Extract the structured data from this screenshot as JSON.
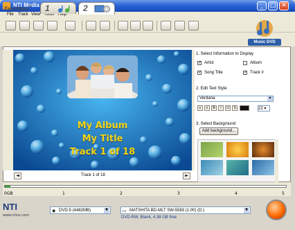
{
  "window": {
    "title": "NTI Media Maker 8",
    "min": "_",
    "max": "□",
    "close": "✕"
  },
  "menu": [
    "File",
    "Track",
    "View",
    "Tools",
    "Help"
  ],
  "toolbar": {
    "icons": [
      "new-icon",
      "open-icon",
      "save-icon",
      "home-icon",
      "refresh-icon",
      "open-folder-icon",
      "image-icon",
      "add-icon",
      "remove-icon",
      "list-icon",
      "settings-icon",
      "burn-settings-icon",
      "options-icon"
    ]
  },
  "steps": {
    "label": "EasySteps",
    "mark": "®",
    "tabs": [
      "1",
      "2"
    ]
  },
  "logo": {
    "text": "Music DVD"
  },
  "preview": {
    "lines": [
      "My Album",
      "My Title",
      "Track 1 of 18"
    ],
    "nav": {
      "prev": "◄",
      "next": "►",
      "label": "Track 1 of 18"
    }
  },
  "panel": {
    "section1": "1. Select Information to Display",
    "checks": [
      {
        "label": "Artist",
        "checked": true
      },
      {
        "label": "Album",
        "checked": false
      },
      {
        "label": "Song Title",
        "checked": true
      },
      {
        "label": "Track #",
        "checked": true
      }
    ],
    "section2": "2. Edit Text Style",
    "font": "Verdana",
    "style_buttons": [
      "B",
      "I",
      "U",
      "S"
    ],
    "font_size": "22",
    "section3": "3. Select Background",
    "add_background": "Add background..."
  },
  "capacity": {
    "labels": [
      "0GB",
      "1",
      "2",
      "3",
      "4",
      "5"
    ],
    "used_fraction": 0.02
  },
  "bottom": {
    "nti": "NTI",
    "nti_url": "www.ntius.com",
    "disc_type": "DVD-5 (4482MB)",
    "drive": "MATSHITA BD-MLT SW-5583 (1.00) (D:)",
    "disc_info": "DVD-RW, Blank, 4.38 GB free"
  },
  "colors": {
    "title_text": "#f2d612",
    "accent": "#2a64d6",
    "progress": "#27a327"
  }
}
